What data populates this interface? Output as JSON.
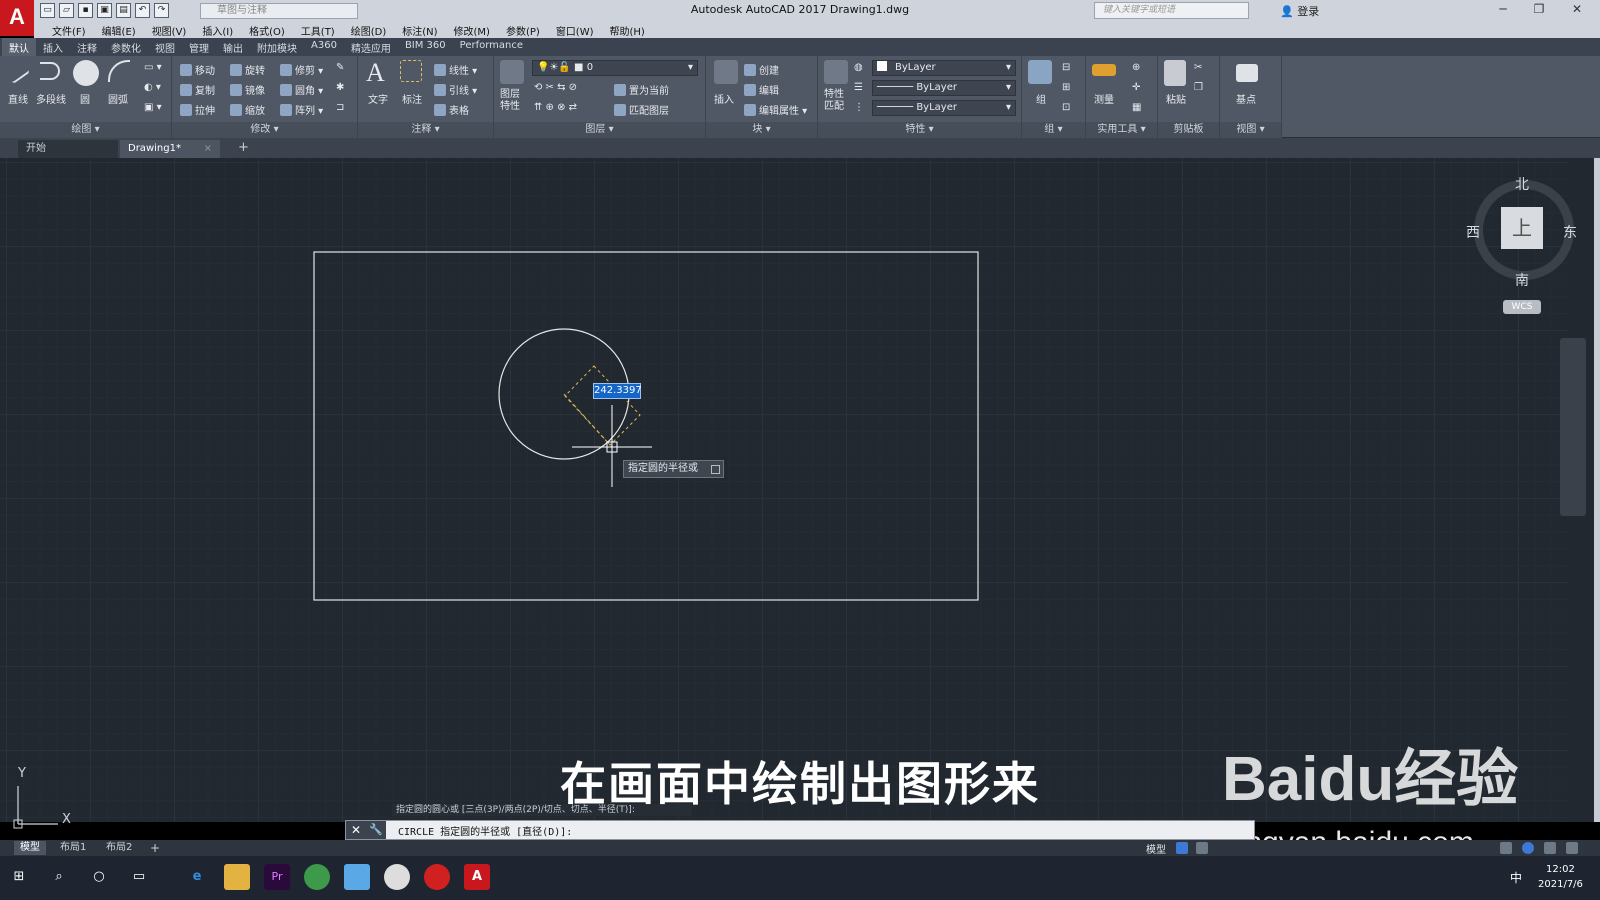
{
  "titlebar": {
    "app_logo": "A",
    "title": "Autodesk AutoCAD 2017    Drawing1.dwg",
    "workspace": "草图与注释",
    "search_placeholder": "键入关键字或短语",
    "login": "登录"
  },
  "menu": [
    "文件(F)",
    "编辑(E)",
    "视图(V)",
    "插入(I)",
    "格式(O)",
    "工具(T)",
    "绘图(D)",
    "标注(N)",
    "修改(M)",
    "参数(P)",
    "窗口(W)",
    "帮助(H)"
  ],
  "ribbon_tabs": [
    "默认",
    "插入",
    "注释",
    "参数化",
    "视图",
    "管理",
    "输出",
    "附加模块",
    "A360",
    "精选应用",
    "BIM 360",
    "Performance"
  ],
  "ribbon": {
    "draw": {
      "title": "绘图",
      "line": "直线",
      "polyline": "多段线",
      "circle": "圆",
      "arc": "圆弧"
    },
    "modify": {
      "title": "修改",
      "move": "移动",
      "rotate": "旋转",
      "trim": "修剪",
      "copy": "复制",
      "mirror": "镜像",
      "fillet": "圆角",
      "stretch": "拉伸",
      "scale": "缩放",
      "array": "阵列"
    },
    "annotation": {
      "title": "注释",
      "text": "文字",
      "dimension": "标注",
      "linear": "线性",
      "leader": "引线",
      "table": "表格"
    },
    "layers": {
      "title": "图层",
      "properties": "图层\n特性",
      "layer_value": "0",
      "make_current": "置为当前",
      "match_layer": "匹配图层"
    },
    "block": {
      "title": "块",
      "insert": "插入",
      "create": "创建",
      "edit": "编辑",
      "edit_attr": "编辑属性"
    },
    "properties": {
      "title": "特性",
      "match": "特性\n匹配",
      "color": "ByLayer",
      "linetype": "ByLayer",
      "lineweight": "ByLayer"
    },
    "groups": {
      "title": "组",
      "group": "组"
    },
    "utilities": {
      "title": "实用工具",
      "measure": "测量"
    },
    "clipboard": {
      "title": "剪贴板",
      "paste": "粘贴"
    },
    "view": {
      "title": "视图",
      "base": "基点"
    }
  },
  "doc_tabs": {
    "start": "开始",
    "drawing": "Drawing1*",
    "add": "+"
  },
  "viewcube": {
    "north": "北",
    "south": "南",
    "east": "东",
    "west": "西",
    "top": "上",
    "wcs": "WCS"
  },
  "drawing": {
    "dynamic_radius": "242.3397",
    "tooltip": "指定圆的半径或",
    "ucs_y": "Y",
    "ucs_x": "X"
  },
  "overlay": {
    "subtitle": "在画面中绘制出图形来",
    "watermark_logo": "Baidu经验",
    "watermark_url": "jingyan.baidu.com"
  },
  "command": {
    "history": "指定圆的圆心或 [三点(3P)/两点(2P)/切点、切点、半径(T)]:",
    "prompt": "CIRCLE 指定圆的半径或 [直径(D)]:"
  },
  "layout_tabs": {
    "model": "模型",
    "layout1": "布局1",
    "layout2": "布局2",
    "add": "+"
  },
  "status": {
    "model": "模型"
  },
  "taskbar": {
    "time": "12:02",
    "date": "2021/7/6",
    "ime": "中"
  }
}
